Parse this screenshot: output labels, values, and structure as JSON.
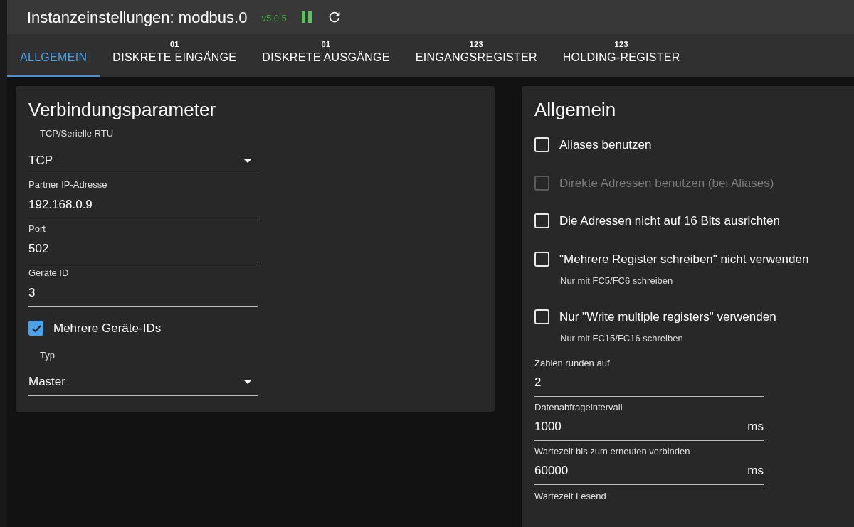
{
  "header": {
    "title": "Instanzeinstellungen: modbus.0",
    "version": "v5.0.5",
    "running": true
  },
  "tabs": [
    {
      "label": "ALLGEMEIN",
      "selected": true
    },
    {
      "label": "DISKRETE EINGÄNGE",
      "badge": "01",
      "selected": false
    },
    {
      "label": "DISKRETE AUSGÄNGE",
      "badge": "01",
      "selected": false
    },
    {
      "label": "EINGANGSREGISTER",
      "badge": "123",
      "selected": false
    },
    {
      "label": "HOLDING-REGISTER",
      "badge": "123",
      "selected": false
    }
  ],
  "left_panel": {
    "title": "Verbindungsparameter",
    "fields": [
      {
        "kind": "select",
        "label": "TCP/Serielle RTU",
        "value": "TCP"
      },
      {
        "kind": "text",
        "label": "Partner IP-Adresse",
        "value": "192.168.0.9"
      },
      {
        "kind": "text",
        "label": "Port",
        "value": "502"
      },
      {
        "kind": "text",
        "label": "Geräte ID",
        "value": "3"
      },
      {
        "kind": "checkbox",
        "label": "Mehrere Geräte-IDs",
        "checked": true,
        "disabled": false
      },
      {
        "kind": "select",
        "label": "Typ",
        "value": "Master"
      }
    ]
  },
  "right_panel": {
    "title": "Allgemein",
    "fields": [
      {
        "kind": "checkbox",
        "label": "Aliases benutzen",
        "checked": false,
        "disabled": false
      },
      {
        "kind": "checkbox",
        "label": "Direkte Adressen benutzen (bei Aliases)",
        "checked": false,
        "disabled": true
      },
      {
        "kind": "checkbox",
        "label": "Die Adressen nicht auf 16 Bits ausrichten",
        "checked": false,
        "disabled": false
      },
      {
        "kind": "checkbox",
        "label": "\"Mehrere Register schreiben\" nicht verwenden",
        "helper": "Nur mit FC5/FC6 schreiben",
        "checked": false,
        "disabled": false
      },
      {
        "kind": "checkbox",
        "label": "Nur \"Write multiple registers\" verwenden",
        "helper": "Nur mit FC15/FC16 schreiben",
        "checked": false,
        "disabled": false
      },
      {
        "kind": "text",
        "label": "Zahlen runden auf",
        "value": "2"
      },
      {
        "kind": "text",
        "label": "Datenabfrageintervall",
        "value": "1000",
        "unit": "ms"
      },
      {
        "kind": "text",
        "label": "Wartezeit bis zum erneuten verbinden",
        "value": "60000",
        "unit": "ms"
      },
      {
        "kind": "label",
        "label": "Wartezeit Lesend"
      }
    ]
  }
}
